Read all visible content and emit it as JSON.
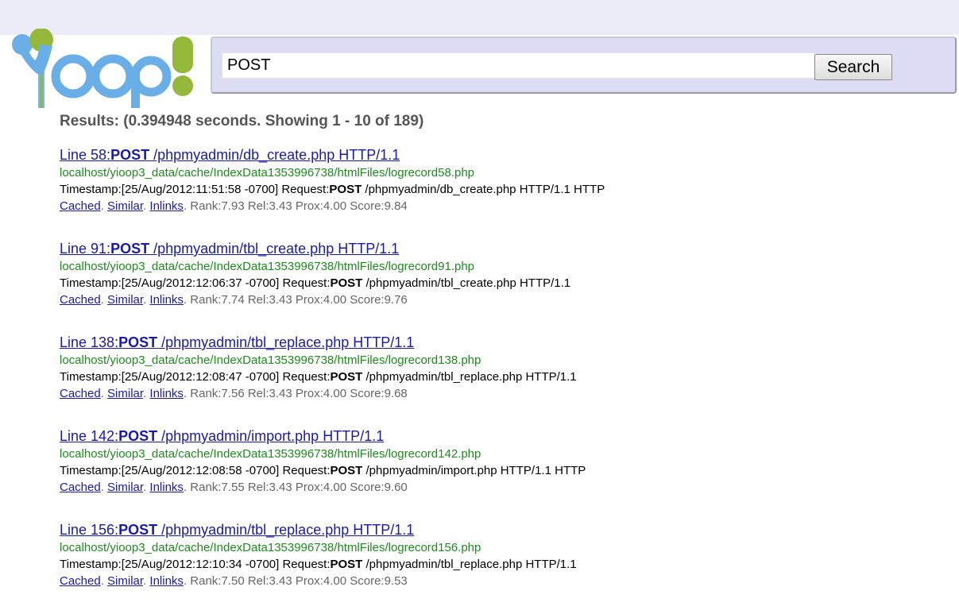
{
  "header": {
    "logo_alt": "Yioop!",
    "brand_colors": {
      "blue": "#6aaee8",
      "green": "#93b83a",
      "gray": "#8b8b8b"
    }
  },
  "search": {
    "query": "POST",
    "button_label": "Search"
  },
  "summary": {
    "text": "Results: (0.394948 seconds. Showing 1 - 10 of 189)"
  },
  "results": [
    {
      "title_prefix": "Line 58:",
      "title_term": "POST",
      "title_rest": " /phpmyadmin/db_create.php HTTP/1.1",
      "url": "localhost/yioop3_data/cache/IndexData1353996738/htmlFiles/logrecord58.php",
      "snippet_prefix": "Timestamp:[25/Aug/2012:11:51:58 -0700] Request:",
      "snippet_term": "POST",
      "snippet_rest": " /phpmyadmin/db_create.php HTTP/1.1 HTTP",
      "cached": "Cached",
      "similar": "Similar",
      "inlinks": "Inlinks",
      "stats": " Rank:7.93 Rel:3.43 Prox:4.00 Score:9.84"
    },
    {
      "title_prefix": "Line 91:",
      "title_term": "POST",
      "title_rest": " /phpmyadmin/tbl_create.php HTTP/1.1",
      "url": "localhost/yioop3_data/cache/IndexData1353996738/htmlFiles/logrecord91.php",
      "snippet_prefix": "Timestamp:[25/Aug/2012:12:06:37 -0700] Request:",
      "snippet_term": "POST",
      "snippet_rest": " /phpmyadmin/tbl_create.php HTTP/1.1",
      "cached": "Cached",
      "similar": "Similar",
      "inlinks": "Inlinks",
      "stats": " Rank:7.74 Rel:3.43 Prox:4.00 Score:9.76"
    },
    {
      "title_prefix": "Line 138:",
      "title_term": "POST",
      "title_rest": " /phpmyadmin/tbl_replace.php HTTP/1.1",
      "url": "localhost/yioop3_data/cache/IndexData1353996738/htmlFiles/logrecord138.php",
      "snippet_prefix": "Timestamp:[25/Aug/2012:12:08:47 -0700] Request:",
      "snippet_term": "POST",
      "snippet_rest": " /phpmyadmin/tbl_replace.php HTTP/1.1",
      "cached": "Cached",
      "similar": "Similar",
      "inlinks": "Inlinks",
      "stats": " Rank:7.56 Rel:3.43 Prox:4.00 Score:9.68"
    },
    {
      "title_prefix": "Line 142:",
      "title_term": "POST",
      "title_rest": " /phpmyadmin/import.php HTTP/1.1",
      "url": "localhost/yioop3_data/cache/IndexData1353996738/htmlFiles/logrecord142.php",
      "snippet_prefix": "Timestamp:[25/Aug/2012:12:08:58 -0700] Request:",
      "snippet_term": "POST",
      "snippet_rest": " /phpmyadmin/import.php HTTP/1.1 HTTP",
      "cached": "Cached",
      "similar": "Similar",
      "inlinks": "Inlinks",
      "stats": " Rank:7.55 Rel:3.43 Prox:4.00 Score:9.60"
    },
    {
      "title_prefix": "Line 156:",
      "title_term": "POST",
      "title_rest": " /phpmyadmin/tbl_replace.php HTTP/1.1",
      "url": "localhost/yioop3_data/cache/IndexData1353996738/htmlFiles/logrecord156.php",
      "snippet_prefix": "Timestamp:[25/Aug/2012:12:10:34 -0700] Request:",
      "snippet_term": "POST",
      "snippet_rest": " /phpmyadmin/tbl_replace.php HTTP/1.1",
      "cached": "Cached",
      "similar": "Similar",
      "inlinks": "Inlinks",
      "stats": " Rank:7.50 Rel:3.43 Prox:4.00 Score:9.53"
    }
  ]
}
